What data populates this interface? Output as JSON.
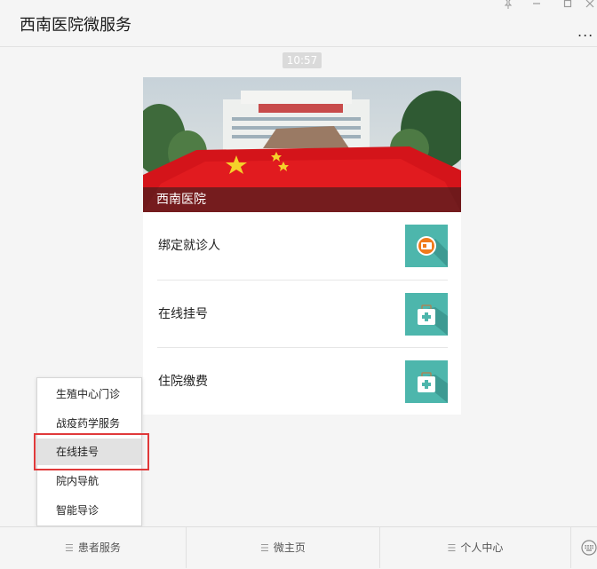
{
  "window": {
    "title": "西南医院微服务",
    "pin_icon": "pin-icon",
    "minimize_icon": "minimize-icon",
    "maximize_icon": "maximize-icon",
    "close_icon": "close-icon",
    "more_label": "..."
  },
  "chat": {
    "timestamp": "10:57"
  },
  "card": {
    "banner_caption": "西南医院",
    "items": [
      {
        "label": "绑定就诊人",
        "icon": "id-card-icon"
      },
      {
        "label": "在线挂号",
        "icon": "medical-bag-icon"
      },
      {
        "label": "住院缴费",
        "icon": "medical-bag-icon"
      }
    ],
    "thumb_color": "#4db6ac"
  },
  "popup_menu": {
    "items": [
      {
        "label": "生殖中心门诊"
      },
      {
        "label": "战疫药学服务"
      },
      {
        "label": "在线挂号",
        "selected": true
      },
      {
        "label": "院内导航"
      },
      {
        "label": "智能导诊"
      }
    ],
    "highlight_color": "#e0393a"
  },
  "bottom_menu": {
    "tabs": [
      {
        "label": "患者服务"
      },
      {
        "label": "微主页"
      },
      {
        "label": "个人中心"
      }
    ],
    "keyboard_icon": "keyboard-icon"
  }
}
